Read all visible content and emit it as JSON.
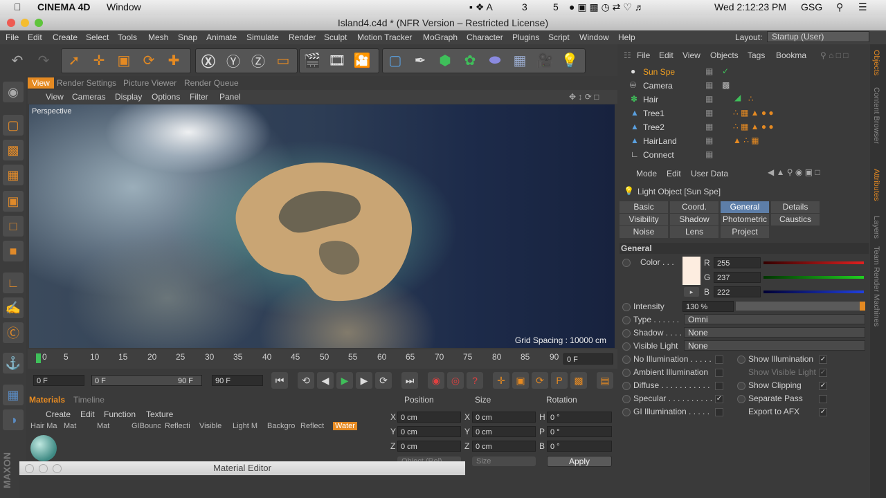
{
  "macbar": {
    "app": "CINEMA 4D",
    "menu": "Window",
    "status": [
      "3",
      "5"
    ],
    "clock": "Wed 2:12:23 PM",
    "user": "GSG"
  },
  "window_title": "Island4.c4d * (NFR Version – Restricted License)",
  "main_menu": [
    "File",
    "Edit",
    "Create",
    "Select",
    "Tools",
    "Mesh",
    "Snap",
    "Animate",
    "Simulate",
    "Render",
    "Sculpt",
    "Motion Tracker",
    "MoGraph",
    "Character",
    "Plugins",
    "Script",
    "Window",
    "Help"
  ],
  "layout": {
    "label": "Layout:",
    "value": "Startup (User)"
  },
  "view_tabs": [
    "View",
    "Render Settings",
    "Picture Viewer",
    "Render Queue"
  ],
  "view_menu": [
    "View",
    "Cameras",
    "Display",
    "Options",
    "Filter",
    "Panel"
  ],
  "viewport": {
    "name": "Perspective",
    "grid": "Grid Spacing : 10000 cm"
  },
  "timeline": {
    "ticks": [
      "0",
      "5",
      "10",
      "15",
      "20",
      "25",
      "30",
      "35",
      "40",
      "45",
      "50",
      "55",
      "60",
      "65",
      "70",
      "75",
      "80",
      "85",
      "90"
    ],
    "current": "0 F",
    "start": "0 F",
    "range_start": "0 F",
    "range_end": "90 F",
    "end": "90 F"
  },
  "materials": {
    "tabs": [
      "Materials",
      "Timeline"
    ],
    "menu": [
      "Create",
      "Edit",
      "Function",
      "Texture"
    ],
    "items": [
      "Hair Ma",
      "Mat",
      "Mat",
      "GIBounc",
      "Reflecti",
      "Visible",
      "Light M",
      "Backgro",
      "Reflect",
      "Water"
    ]
  },
  "coords": {
    "headers": [
      "Position",
      "Size",
      "Rotation"
    ],
    "rows": [
      {
        "a": "X",
        "av": "0 cm",
        "b": "X",
        "bv": "0 cm",
        "c": "H",
        "cv": "0 °"
      },
      {
        "a": "Y",
        "av": "0 cm",
        "b": "Y",
        "bv": "0 cm",
        "c": "P",
        "cv": "0 °"
      },
      {
        "a": "Z",
        "av": "0 cm",
        "b": "Z",
        "bv": "0 cm",
        "c": "B",
        "cv": "0 °"
      }
    ],
    "apply": "Apply",
    "object_mode": "Object (Rel)",
    "size_mode": "Size"
  },
  "material_editor": {
    "title": "Material Editor"
  },
  "objects": {
    "menu": [
      "File",
      "Edit",
      "View",
      "Objects",
      "Tags",
      "Bookma"
    ],
    "items": [
      "Sun Spe",
      "Camera",
      "Hair",
      "Tree1",
      "Tree2",
      "HairLand",
      "Connect"
    ]
  },
  "attributes": {
    "menu": [
      "Mode",
      "Edit",
      "User Data"
    ],
    "title": "Light Object [Sun Spe]",
    "tabs": [
      "Basic",
      "Coord.",
      "General",
      "Details",
      "Visibility",
      "Shadow",
      "Photometric",
      "Caustics",
      "Noise",
      "Lens",
      "Project"
    ],
    "active_tab": "General",
    "section": "General",
    "color_label": "Color . . .",
    "color_hex": "#fdede0",
    "rgb": [
      {
        "l": "R",
        "v": "255"
      },
      {
        "l": "G",
        "v": "237"
      },
      {
        "l": "B",
        "v": "222"
      }
    ],
    "intensity_label": "Intensity",
    "intensity": "130 %",
    "type_label": "Type . . . . . .",
    "type_value": "Omni",
    "shadow_label": "Shadow . . . .",
    "shadow_value": "None",
    "visible_light_label": "Visible Light",
    "visible_light_value": "None",
    "left_checks": [
      {
        "label": "No Illumination . . . . .",
        "checked": false
      },
      {
        "label": "Ambient Illumination",
        "checked": false
      },
      {
        "label": "Diffuse . . . . . . . . . . .",
        "checked": false
      },
      {
        "label": "Specular . . . . . . . . . .",
        "checked": true
      },
      {
        "label": "GI Illumination . . . . .",
        "checked": false
      }
    ],
    "right_checks": [
      {
        "label": "Show Illumination",
        "checked": true
      },
      {
        "label": "Show Visible Light",
        "checked": true
      },
      {
        "label": "Show Clipping",
        "checked": true
      },
      {
        "label": "Separate Pass",
        "checked": false
      },
      {
        "label": "Export to AFX",
        "checked": true
      }
    ]
  },
  "side_tabs": [
    "Objects",
    "Content Browser",
    "Attributes",
    "Layers",
    "Team Render Machines"
  ],
  "colors": {
    "accent": "#e58a22",
    "active_tab": "#5d7ea8",
    "selected_object": "#f2a020"
  }
}
